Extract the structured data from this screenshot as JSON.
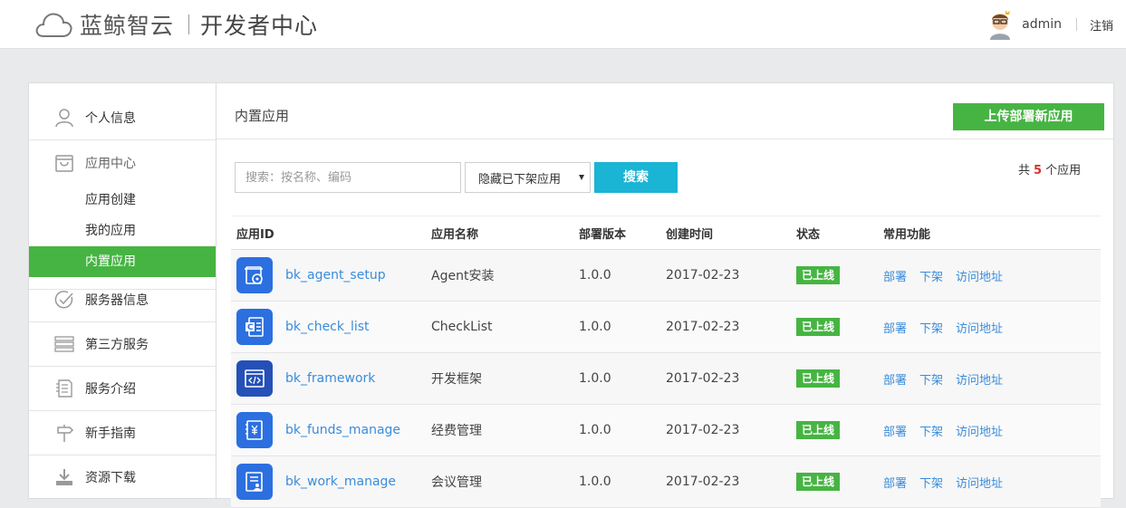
{
  "header": {
    "brand": "蓝鲸智云",
    "portal": "开发者中心",
    "username": "admin",
    "logout": "注销",
    "icons": {
      "logo": "cloud-logo-icon",
      "avatar": "user-avatar"
    }
  },
  "sidebar": {
    "personal": {
      "label": "个人信息",
      "icon": "user-icon"
    },
    "app_center": {
      "label": "应用中心",
      "icon": "bag-icon",
      "subitems": [
        {
          "label": "应用创建",
          "active": false
        },
        {
          "label": "我的应用",
          "active": false
        },
        {
          "label": "内置应用",
          "active": true
        }
      ]
    },
    "server": {
      "label": "服务器信息",
      "icon": "check-circle-icon"
    },
    "third_party": {
      "label": "第三方服务",
      "icon": "list-icon"
    },
    "service_intro": {
      "label": "服务介绍",
      "icon": "document-icon"
    },
    "guide": {
      "label": "新手指南",
      "icon": "signpost-icon"
    },
    "download": {
      "label": "资源下载",
      "icon": "download-icon"
    }
  },
  "main": {
    "title": "内置应用",
    "upload_button": "上传部署新应用",
    "search_placeholder": "搜索：按名称、编码",
    "filter_value": "隐藏已下架应用",
    "search_button": "搜索",
    "count_prefix": "共",
    "count": "5",
    "count_suffix": "个应用"
  },
  "table": {
    "headers": [
      "应用ID",
      "应用名称",
      "部署版本",
      "创建时间",
      "状态",
      "常用功能"
    ],
    "rows": [
      {
        "id": "bk_agent_setup",
        "name": "Agent安装",
        "version": "1.0.0",
        "created": "2017-02-23",
        "status": "已上线",
        "icon": "install-disc-icon"
      },
      {
        "id": "bk_check_list",
        "name": "CheckList",
        "version": "1.0.0",
        "created": "2017-02-23",
        "status": "已上线",
        "icon": "checklist-icon"
      },
      {
        "id": "bk_framework",
        "name": "开发框架",
        "version": "1.0.0",
        "created": "2017-02-23",
        "status": "已上线",
        "icon": "code-window-icon"
      },
      {
        "id": "bk_funds_manage",
        "name": "经费管理",
        "version": "1.0.0",
        "created": "2017-02-23",
        "status": "已上线",
        "icon": "yen-book-icon"
      },
      {
        "id": "bk_work_manage",
        "name": "会议管理",
        "version": "1.0.0",
        "created": "2017-02-23",
        "status": "已上线",
        "icon": "meeting-doc-icon"
      }
    ],
    "ops": [
      "部署",
      "下架",
      "访问地址"
    ]
  },
  "colors": {
    "green": "#46b442",
    "blue": "#1ab4d4",
    "link": "#3a8cdb",
    "red": "#d9302c"
  }
}
